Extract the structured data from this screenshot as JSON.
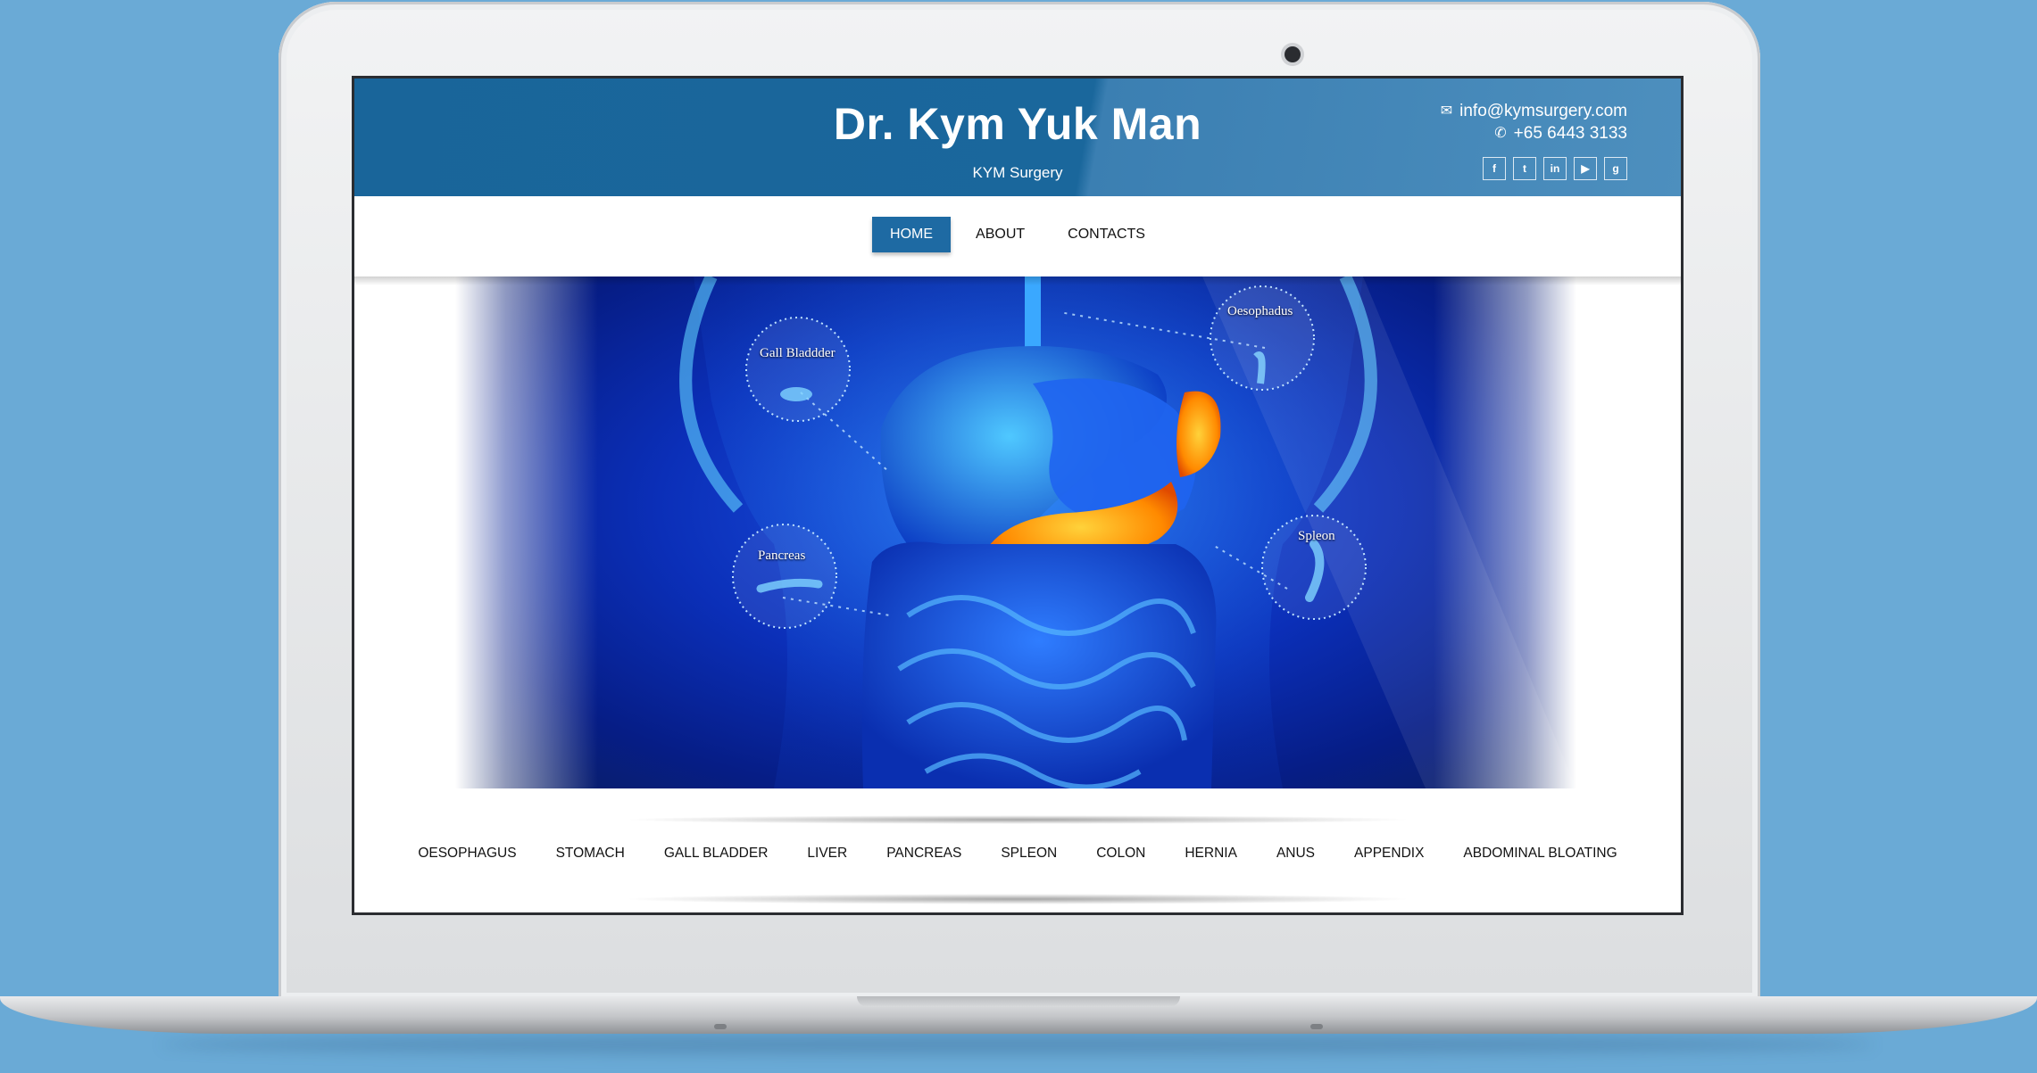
{
  "header": {
    "title": "Dr. Kym Yuk Man",
    "subtitle": "KYM Surgery",
    "email": "info@kymsurgery.com",
    "phone": "+65 6443 3133",
    "social": [
      {
        "name": "facebook",
        "glyph": "f"
      },
      {
        "name": "twitter",
        "glyph": "t"
      },
      {
        "name": "linkedin",
        "glyph": "in"
      },
      {
        "name": "youtube",
        "glyph": "▶"
      },
      {
        "name": "google-plus",
        "glyph": "g"
      }
    ]
  },
  "nav": {
    "items": [
      {
        "label": "HOME",
        "active": true
      },
      {
        "label": "ABOUT",
        "active": false
      },
      {
        "label": "CONTACTS",
        "active": false
      }
    ]
  },
  "hero": {
    "labels": {
      "gall_bladder": "Gall Bladdder",
      "oesophagus": "Oesophadus",
      "pancreas": "Pancreas",
      "spleen": "Spleon"
    }
  },
  "organs": {
    "items": [
      "OESOPHAGUS",
      "STOMACH",
      "GALL BLADDER",
      "LIVER",
      "PANCREAS",
      "SPLEON",
      "COLON",
      "HERNIA",
      "ANUS",
      "APPENDIX",
      "ABDOMINAL BLOATING"
    ]
  },
  "colors": {
    "brand": "#1a679c",
    "background": "#6aaad6",
    "highlight_organ": "#ff8a00"
  }
}
